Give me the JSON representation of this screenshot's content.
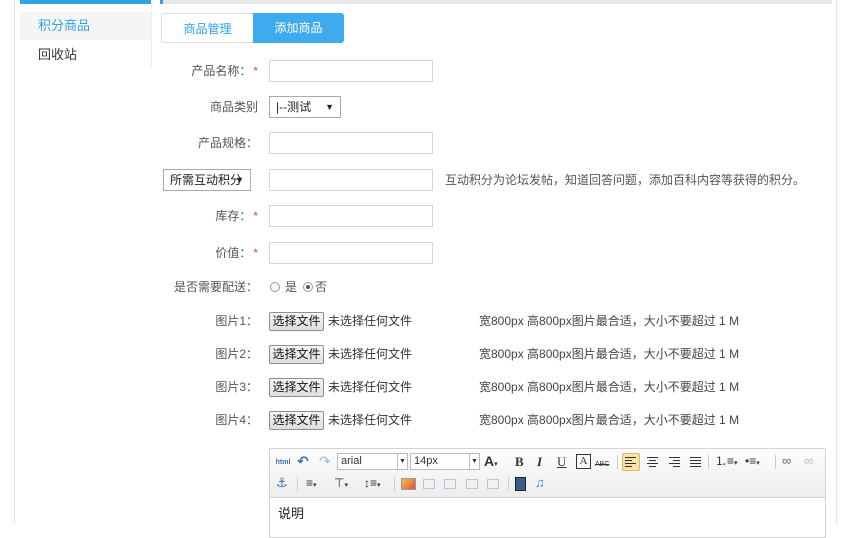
{
  "sidebar": {
    "items": [
      {
        "label": "积分商品",
        "active": true
      },
      {
        "label": "回收站",
        "active": false
      }
    ]
  },
  "tabs": [
    {
      "label": "商品管理",
      "active": false
    },
    {
      "label": "添加商品",
      "active": true
    }
  ],
  "form": {
    "product_name_label": "产品名称：",
    "category_label": "商品类别",
    "category_value": "|--测试",
    "spec_label": "产品规格：",
    "points_type_value": "所需互动积分",
    "points_hint": "互动积分为论坛发帖，知道回答问题，添加百科内容等获得的积分。",
    "stock_label": "库存：",
    "value_label": "价值：",
    "delivery_label": "是否需要配送：",
    "delivery_yes": "是",
    "delivery_no": "否",
    "required_mark": "*",
    "pictures": [
      {
        "label": "图片1：",
        "button": "选择文件",
        "status": "未选择任何文件",
        "hint": "宽800px 高800px图片最合适，大小不要超过 1 M"
      },
      {
        "label": "图片2：",
        "button": "选择文件",
        "status": "未选择任何文件",
        "hint": "宽800px 高800px图片最合适，大小不要超过 1 M"
      },
      {
        "label": "图片3：",
        "button": "选择文件",
        "status": "未选择任何文件",
        "hint": "宽800px 高800px图片最合适，大小不要超过 1 M"
      },
      {
        "label": "图片4：",
        "button": "选择文件",
        "status": "未选择任何文件",
        "hint": "宽800px 高800px图片最合适，大小不要超过 1 M"
      }
    ]
  },
  "editor": {
    "html_label": "html",
    "font_family": "arial",
    "font_size": "14px",
    "bold": "B",
    "italic": "I",
    "underline": "U",
    "strike": "ABC",
    "font_color": "A",
    "body_text": "说明"
  },
  "colors": {
    "accent": "#2fa3e6",
    "tab_active": "#3fabef",
    "required": "#e44444"
  }
}
